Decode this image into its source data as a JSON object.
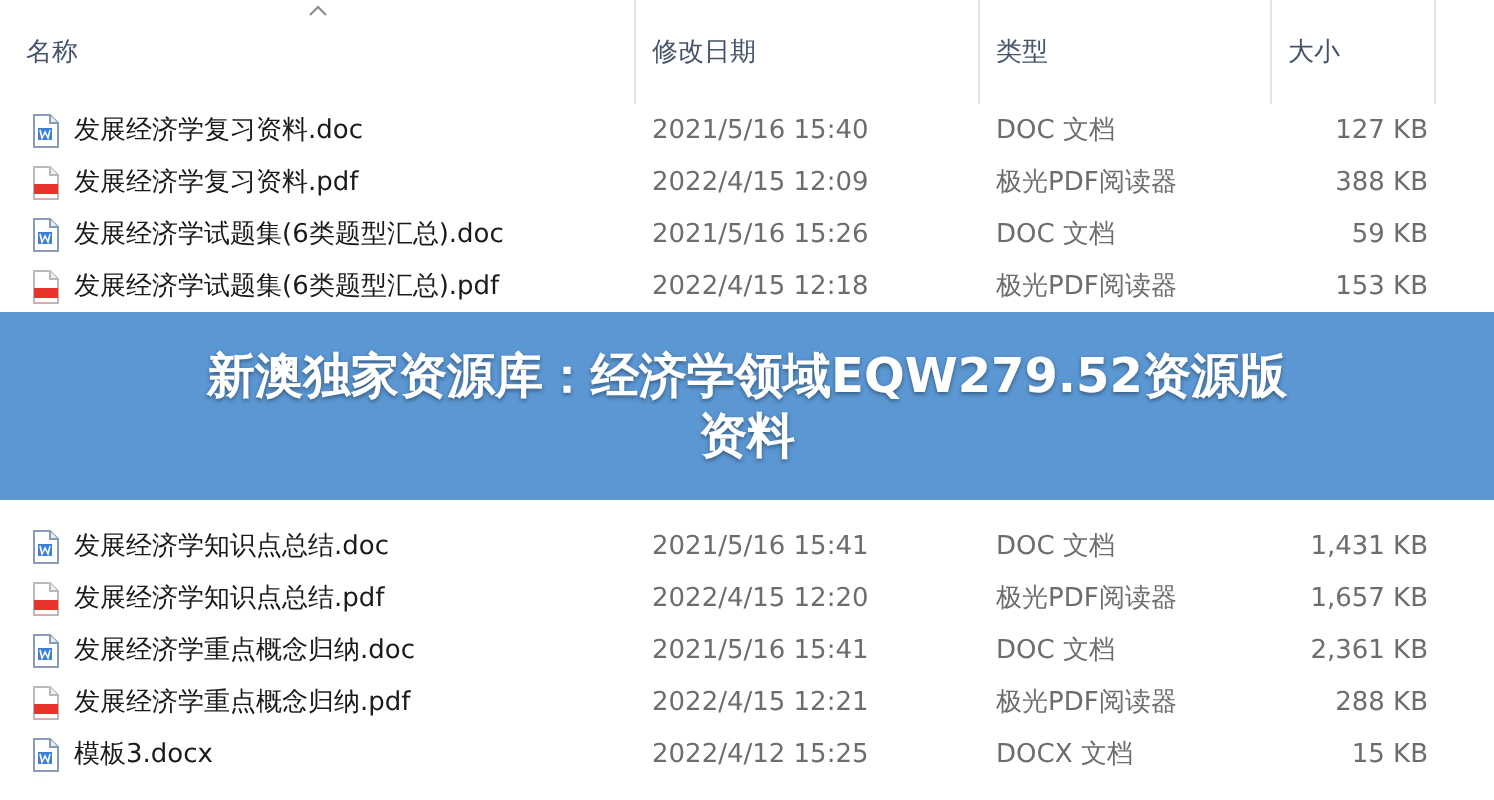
{
  "columns": [
    {
      "label": "名称",
      "sorted": true
    },
    {
      "label": "修改日期",
      "sorted": false
    },
    {
      "label": "类型",
      "sorted": false
    },
    {
      "label": "大小",
      "sorted": false
    }
  ],
  "files_above": [
    {
      "kind": "word",
      "name": "发展经济学复习资料.doc",
      "modified": "2021/5/16 15:40",
      "type": "DOC 文档",
      "size": "127 KB"
    },
    {
      "kind": "pdf",
      "name": "发展经济学复习资料.pdf",
      "modified": "2022/4/15 12:09",
      "type": "极光PDF阅读器",
      "size": "388 KB"
    },
    {
      "kind": "word",
      "name": "发展经济学试题集(6类题型汇总).doc",
      "modified": "2021/5/16 15:26",
      "type": "DOC 文档",
      "size": "59 KB"
    },
    {
      "kind": "pdf",
      "name": "发展经济学试题集(6类题型汇总).pdf",
      "modified": "2022/4/15 12:18",
      "type": "极光PDF阅读器",
      "size": "153 KB"
    }
  ],
  "banner": {
    "lines": [
      "新澳独家资源库：经济学领域EQW279.52资源版",
      "资料"
    ]
  },
  "files_below": [
    {
      "kind": "word",
      "name": "发展经济学知识点总结.doc",
      "modified": "2021/5/16 15:41",
      "type": "DOC 文档",
      "size": "1,431 KB"
    },
    {
      "kind": "pdf",
      "name": "发展经济学知识点总结.pdf",
      "modified": "2022/4/15 12:20",
      "type": "极光PDF阅读器",
      "size": "1,657 KB"
    },
    {
      "kind": "word",
      "name": "发展经济学重点概念归纳.doc",
      "modified": "2021/5/16 15:41",
      "type": "DOC 文档",
      "size": "2,361 KB"
    },
    {
      "kind": "pdf",
      "name": "发展经济学重点概念归纳.pdf",
      "modified": "2022/4/15 12:21",
      "type": "极光PDF阅读器",
      "size": "288 KB"
    },
    {
      "kind": "word",
      "name": "模板3.docx",
      "modified": "2022/4/12 15:25",
      "type": "DOCX 文档",
      "size": "15 KB"
    }
  ]
}
